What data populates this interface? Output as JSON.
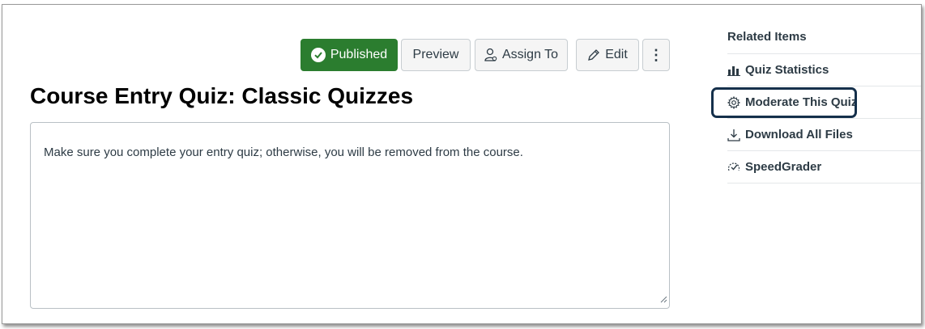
{
  "toolbar": {
    "published_label": "Published",
    "preview_label": "Preview",
    "assign_label": "Assign To",
    "edit_label": "Edit",
    "more_label": "⋮"
  },
  "quiz": {
    "title": "Course Entry Quiz: Classic Quizzes",
    "description": "Make sure you complete your entry quiz; otherwise, you will be removed from the course."
  },
  "related": {
    "title": "Related Items",
    "items": [
      {
        "label": "Quiz Statistics",
        "icon": "bar-chart-icon"
      },
      {
        "label": "Moderate This Quiz",
        "icon": "gear-icon"
      },
      {
        "label": "Download All Files",
        "icon": "download-icon"
      },
      {
        "label": "SpeedGrader",
        "icon": "speedgrader-icon"
      }
    ]
  },
  "colors": {
    "published_green": "#2b7d2f",
    "focus_ring": "#15304b",
    "text": "#2d3b45"
  }
}
